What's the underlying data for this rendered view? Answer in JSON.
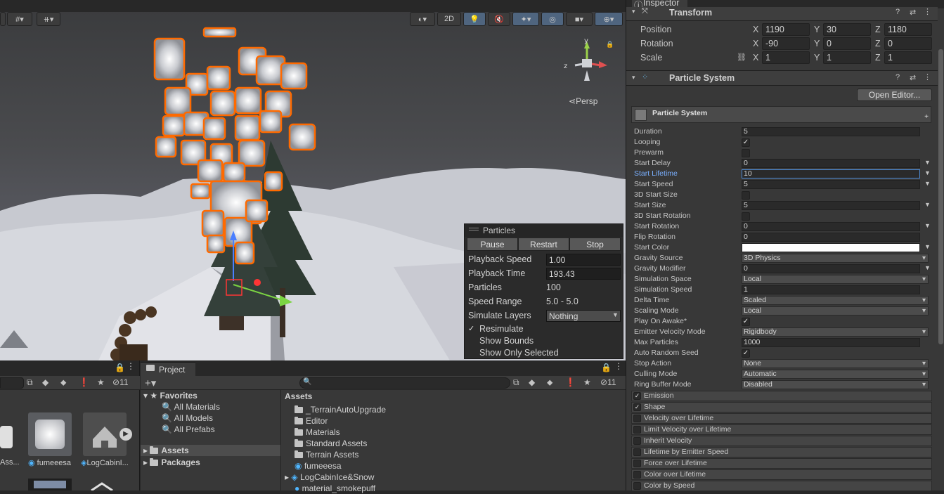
{
  "scene": {
    "view_mode_label": "2D",
    "persp_label": "Persp",
    "gizmo_axes": {
      "y": "y",
      "z": "z"
    }
  },
  "particles_panel": {
    "title": "Particles",
    "buttons": [
      "Pause",
      "Restart",
      "Stop"
    ],
    "rows": [
      {
        "label": "Playback Speed",
        "value": "1.00"
      },
      {
        "label": "Playback Time",
        "value": "193.43"
      },
      {
        "label": "Particles",
        "value": "100"
      },
      {
        "label": "Speed Range",
        "value": "5.0 - 5.0"
      },
      {
        "label": "Simulate Layers",
        "value": "Nothing"
      }
    ],
    "checks": [
      {
        "label": "Resimulate",
        "checked": true
      },
      {
        "label": "Show Bounds",
        "checked": false
      },
      {
        "label": "Show Only Selected",
        "checked": false
      }
    ]
  },
  "hierarchy": {
    "hidden_count": "11",
    "items": [
      {
        "label": "Ass..."
      },
      {
        "label": "fumeeesa"
      },
      {
        "label": "LogCabinI..."
      }
    ]
  },
  "project": {
    "tab_label": "Project",
    "hidden_count": "11",
    "favorites": {
      "label": "Favorites",
      "items": [
        "All Materials",
        "All Models",
        "All Prefabs"
      ]
    },
    "roots": [
      "Assets",
      "Packages"
    ],
    "assets_header": "Assets",
    "assets": [
      {
        "label": "_TerrainAutoUpgrade",
        "kind": "folder"
      },
      {
        "label": "Editor",
        "kind": "folder"
      },
      {
        "label": "Materials",
        "kind": "folder"
      },
      {
        "label": "Standard Assets",
        "kind": "folder"
      },
      {
        "label": "Terrain Assets",
        "kind": "folder"
      },
      {
        "label": "fumeeesa",
        "kind": "particle"
      },
      {
        "label": "LogCabinIce&Snow",
        "kind": "prefab"
      },
      {
        "label": "material_smokepuff",
        "kind": "material"
      }
    ]
  },
  "inspector": {
    "tab_label": "Inspector",
    "transform": {
      "title": "Transform",
      "rows": [
        {
          "label": "Position",
          "x": "1190",
          "y": "30",
          "z": "1180"
        },
        {
          "label": "Rotation",
          "x": "-90",
          "y": "0",
          "z": "0"
        },
        {
          "label": "Scale",
          "x": "1",
          "y": "1",
          "z": "1"
        }
      ]
    },
    "particle_system": {
      "title": "Particle System",
      "open_editor_label": "Open Editor...",
      "header_label": "Particle System",
      "props": [
        {
          "label": "Duration",
          "type": "num",
          "value": "5"
        },
        {
          "label": "Looping",
          "type": "check",
          "checked": true
        },
        {
          "label": "Prewarm",
          "type": "check",
          "checked": false
        },
        {
          "label": "Start Delay",
          "type": "num",
          "value": "0",
          "arrow": true
        },
        {
          "label": "Start Lifetime",
          "type": "num",
          "value": "10",
          "arrow": true,
          "active": true
        },
        {
          "label": "Start Speed",
          "type": "num",
          "value": "5",
          "arrow": true
        },
        {
          "label": "3D Start Size",
          "type": "check",
          "checked": false
        },
        {
          "label": "Start Size",
          "type": "num",
          "value": "5",
          "arrow": true
        },
        {
          "label": "3D Start Rotation",
          "type": "check",
          "checked": false
        },
        {
          "label": "Start Rotation",
          "type": "num",
          "value": "0",
          "arrow": true
        },
        {
          "label": "Flip Rotation",
          "type": "num",
          "value": "0"
        },
        {
          "label": "Start Color",
          "type": "color",
          "value": "#ffffff",
          "arrow": true
        },
        {
          "label": "Gravity Source",
          "type": "drop",
          "value": "3D Physics"
        },
        {
          "label": "Gravity Modifier",
          "type": "num",
          "value": "0",
          "arrow": true
        },
        {
          "label": "Simulation Space",
          "type": "drop",
          "value": "Local"
        },
        {
          "label": "Simulation Speed",
          "type": "num",
          "value": "1"
        },
        {
          "label": "Delta Time",
          "type": "drop",
          "value": "Scaled"
        },
        {
          "label": "Scaling Mode",
          "type": "drop",
          "value": "Local"
        },
        {
          "label": "Play On Awake*",
          "type": "check",
          "checked": true
        },
        {
          "label": "Emitter Velocity Mode",
          "type": "drop",
          "value": "Rigidbody"
        },
        {
          "label": "Max Particles",
          "type": "num",
          "value": "1000"
        },
        {
          "label": "Auto Random Seed",
          "type": "check",
          "checked": true
        },
        {
          "label": "Stop Action",
          "type": "drop",
          "value": "None"
        },
        {
          "label": "Culling Mode",
          "type": "drop",
          "value": "Automatic"
        },
        {
          "label": "Ring Buffer Mode",
          "type": "drop",
          "value": "Disabled"
        }
      ],
      "modules": [
        {
          "label": "Emission",
          "checked": true
        },
        {
          "label": "Shape",
          "checked": true
        },
        {
          "label": "Velocity over Lifetime",
          "checked": false
        },
        {
          "label": "Limit Velocity over Lifetime",
          "checked": false
        },
        {
          "label": "Inherit Velocity",
          "checked": false
        },
        {
          "label": "Lifetime by Emitter Speed",
          "checked": false
        },
        {
          "label": "Force over Lifetime",
          "checked": false
        },
        {
          "label": "Color over Lifetime",
          "checked": false
        },
        {
          "label": "Color by Speed",
          "checked": false
        }
      ]
    }
  },
  "colors": {
    "selection_outline": "#ff6a00",
    "accent_blue": "#4f657f",
    "active_label": "#7ab0ff"
  }
}
